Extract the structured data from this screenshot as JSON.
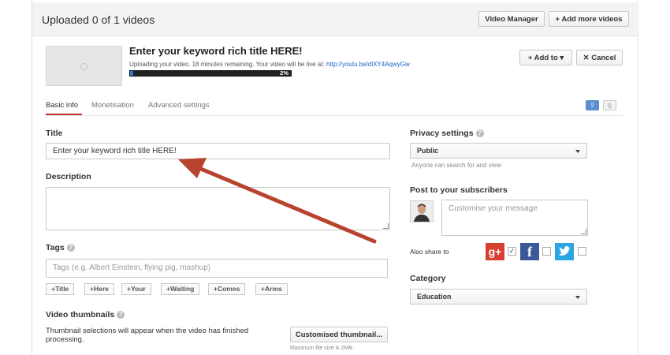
{
  "header": {
    "title": "Uploaded 0 of 1 videos",
    "video_manager": "Video Manager",
    "add_more": "+ Add more videos"
  },
  "upload": {
    "title": "Enter your keyword rich title HERE!",
    "status_text": "Uploading your video. 18 minutes remaining. Your video will be live at:",
    "link": "http://youtu.be/dlXY4AqwyGw",
    "progress_percent": 2,
    "progress_label": "2%",
    "add_to": "Add to",
    "cancel": "Cancel"
  },
  "tabs": [
    {
      "label": "Basic info",
      "active": true
    },
    {
      "label": "Monetisation",
      "active": false
    },
    {
      "label": "Advanced settings",
      "active": false
    }
  ],
  "form": {
    "title_label": "Title",
    "title_value": "Enter your keyword rich title HERE!",
    "description_label": "Description",
    "tags_label": "Tags",
    "tags_placeholder": "Tags (e.g. Albert Einstein, flying pig, mashup)",
    "suggested_tags": [
      "+Title",
      "+Here",
      "+Your",
      "+Waiting",
      "+Comes",
      "+Arms"
    ],
    "thumbnails_label": "Video thumbnails",
    "thumbnails_note": "Thumbnail selections will appear when the video has finished processing.",
    "custom_thumb_button": "Customised thumbnail...",
    "max_size_note": "Maximum file size is 2MB."
  },
  "sidebar": {
    "privacy_label": "Privacy settings",
    "privacy_value": "Public",
    "privacy_note": "Anyone can search for and view",
    "post_label": "Post to your subscribers",
    "message_placeholder": "Customise your message",
    "share_label": "Also share to",
    "gplus_checked": true,
    "facebook_checked": false,
    "twitter_checked": false,
    "category_label": "Category",
    "category_value": "Education"
  },
  "colors": {
    "accent_top": "#e87a2e",
    "progress": "#2b7bd1",
    "arrow": "#b8432e",
    "gplus": "#d6402f",
    "facebook": "#3b5998",
    "twitter": "#2aa4e3"
  }
}
